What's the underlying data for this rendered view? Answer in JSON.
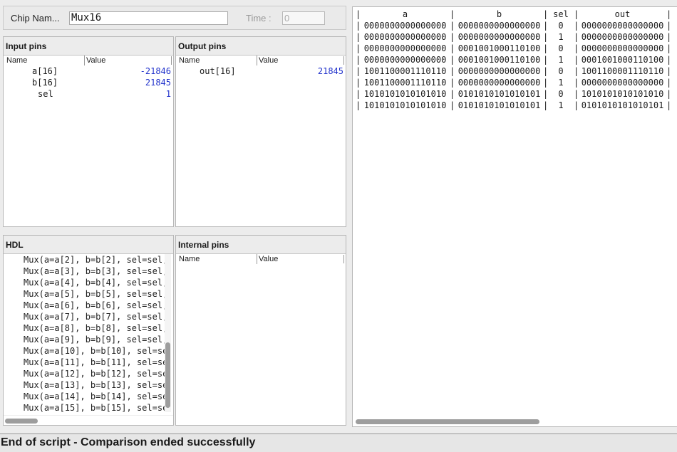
{
  "toolbar": {
    "chip_label": "Chip Nam...",
    "chip_value": "Mux16",
    "time_label": "Time :",
    "time_value": "0"
  },
  "input_pins": {
    "title": "Input pins",
    "col_name": "Name",
    "col_value": "Value",
    "rows": [
      {
        "name": "a[16]",
        "value": "-21846"
      },
      {
        "name": "b[16]",
        "value": "21845"
      },
      {
        "name": "sel",
        "value": "1"
      }
    ]
  },
  "output_pins": {
    "title": "Output pins",
    "col_name": "Name",
    "col_value": "Value",
    "rows": [
      {
        "name": "out[16]",
        "value": "21845"
      }
    ]
  },
  "hdl": {
    "title": "HDL",
    "lines": [
      "Mux(a=a[2], b=b[2], sel=sel,",
      "Mux(a=a[3], b=b[3], sel=sel,",
      "Mux(a=a[4], b=b[4], sel=sel,",
      "Mux(a=a[5], b=b[5], sel=sel,",
      "Mux(a=a[6], b=b[6], sel=sel,",
      "Mux(a=a[7], b=b[7], sel=sel,",
      "Mux(a=a[8], b=b[8], sel=sel,",
      "Mux(a=a[9], b=b[9], sel=sel,",
      "Mux(a=a[10], b=b[10], sel=se",
      "Mux(a=a[11], b=b[11], sel=se",
      "Mux(a=a[12], b=b[12], sel=se",
      "Mux(a=a[13], b=b[13], sel=se",
      "Mux(a=a[14], b=b[14], sel=se",
      "Mux(a=a[15], b=b[15], sel=se"
    ]
  },
  "internal_pins": {
    "title": "Internal pins",
    "col_name": "Name",
    "col_value": "Value"
  },
  "compare": {
    "headers": [
      "a",
      "b",
      "sel",
      "out"
    ],
    "rows": [
      [
        "0000000000000000",
        "0000000000000000",
        "0",
        "0000000000000000"
      ],
      [
        "0000000000000000",
        "0000000000000000",
        "1",
        "0000000000000000"
      ],
      [
        "0000000000000000",
        "0001001000110100",
        "0",
        "0000000000000000"
      ],
      [
        "0000000000000000",
        "0001001000110100",
        "1",
        "0001001000110100"
      ],
      [
        "1001100001110110",
        "0000000000000000",
        "0",
        "1001100001110110"
      ],
      [
        "1001100001110110",
        "0000000000000000",
        "1",
        "0000000000000000"
      ],
      [
        "1010101010101010",
        "0101010101010101",
        "0",
        "1010101010101010"
      ],
      [
        "1010101010101010",
        "0101010101010101",
        "1",
        "0101010101010101"
      ]
    ],
    "highlighted_row": 7,
    "highlight_color": "#ffff00"
  },
  "status": {
    "text": "End of script - Comparison ended successfully"
  }
}
